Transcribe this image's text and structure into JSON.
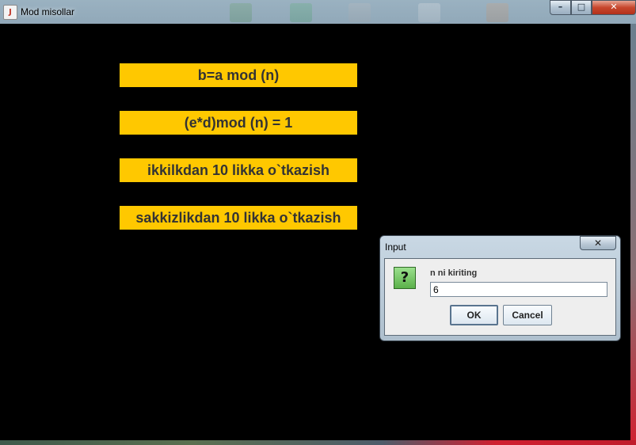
{
  "window": {
    "title": "Mod misollar",
    "minimize_glyph": "–",
    "maximize_glyph": "□",
    "close_glyph": "✕",
    "app_icon": "java-cup-icon"
  },
  "menu": {
    "items": [
      {
        "label": "b=a mod (n)"
      },
      {
        "label": "(e*d)mod (n) = 1"
      },
      {
        "label": "ikkilkdan 10 likka o`tkazish"
      },
      {
        "label": "sakkizlikdan 10 likka o`tkazish"
      }
    ],
    "button_color": "#ffc800"
  },
  "dialog": {
    "title": "Input",
    "close_glyph": "✕",
    "icon": "question-icon",
    "icon_glyph": "?",
    "prompt": "n ni kiriting",
    "input_value": "6",
    "ok_label": "OK",
    "cancel_label": "Cancel"
  }
}
